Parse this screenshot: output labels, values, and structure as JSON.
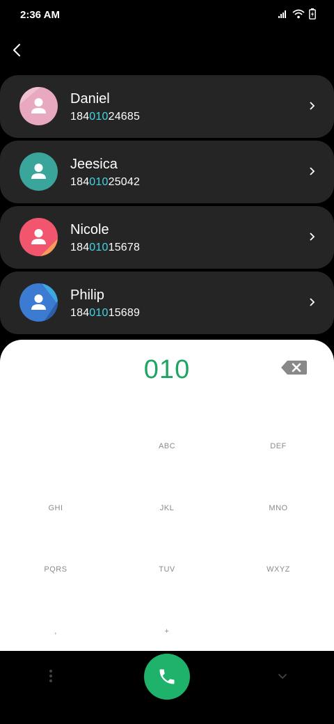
{
  "status": {
    "time": "2:36 AM"
  },
  "contacts": [
    {
      "name": "Daniel",
      "number_pre": "184",
      "number_hl": "010",
      "number_post": "24685",
      "avatar_color": "#e8a8c0"
    },
    {
      "name": "Jeesica",
      "number_pre": "184",
      "number_hl": "010",
      "number_post": "25042",
      "avatar_color": "#3aa59b"
    },
    {
      "name": "Nicole",
      "number_pre": "184",
      "number_hl": "010",
      "number_post": "15678",
      "avatar_color": "#f2566e"
    },
    {
      "name": "Philip",
      "number_pre": "184",
      "number_hl": "010",
      "number_post": "15689",
      "avatar_color": "#3b7bd2"
    }
  ],
  "dialpad": {
    "number": "010",
    "keys": [
      "",
      "ABC",
      "DEF",
      "GHI",
      "JKL",
      "MNO",
      "PQRS",
      "TUV",
      "WXYZ",
      ",",
      "+",
      ""
    ]
  },
  "colors": {
    "highlight": "#3fd6e6",
    "dial_number": "#1fa463",
    "call_button": "#1fb26a",
    "card_bg": "#252525"
  },
  "icons": [
    "back-arrow-icon",
    "chevron-right-icon",
    "backspace-icon",
    "phone-icon",
    "more-options-icon",
    "chevron-down-icon",
    "signal-icon",
    "wifi-icon",
    "battery-icon"
  ]
}
